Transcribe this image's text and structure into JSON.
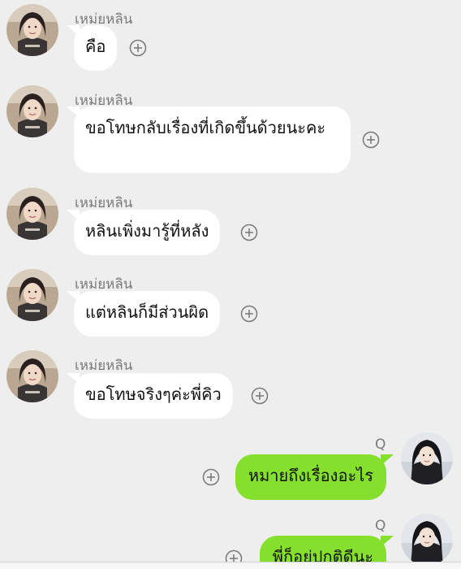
{
  "colors": {
    "background": "#eeeeee",
    "incoming_bubble": "#ffffff",
    "outgoing_bubble": "#84e02c",
    "sender_name": "#7a7a7a"
  },
  "messages": [
    {
      "sender": "เหม่ยหลิน",
      "text": "คือ",
      "direction": "incoming"
    },
    {
      "sender": "เหม่ยหลิน",
      "text": "ขอโทษกลับเรื่องที่เกิดขึ้นด้วยนะคะ",
      "direction": "incoming"
    },
    {
      "sender": "เหม่ยหลิน",
      "text": "หลินเพิ่งมารู้ที่หลัง",
      "direction": "incoming"
    },
    {
      "sender": "เหม่ยหลิน",
      "text": "แต่หลินก็มีส่วนผิด",
      "direction": "incoming"
    },
    {
      "sender": "เหม่ยหลิน",
      "text": "ขอโทษจริงๆค่ะพี่คิว",
      "direction": "incoming"
    },
    {
      "sender": "Q",
      "text": "หมายถึงเรื่องอะไร",
      "direction": "outgoing"
    },
    {
      "sender": "Q",
      "text": "พี่ก็อยู่ปกติดีนะ",
      "direction": "outgoing"
    }
  ],
  "icons": {
    "add_reaction": "plus-circle-icon",
    "incoming_avatar": "avatar-meilin",
    "outgoing_avatar": "avatar-q"
  }
}
